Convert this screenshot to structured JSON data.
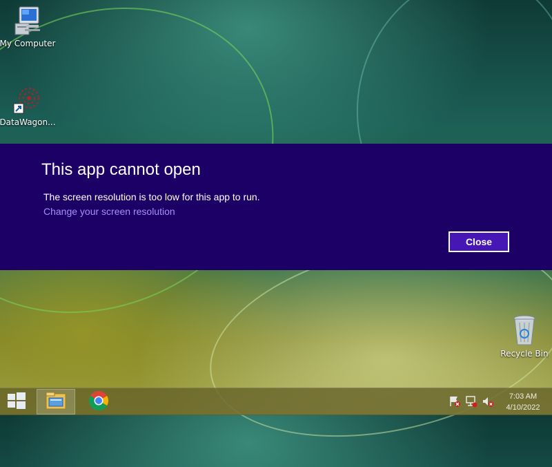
{
  "desktop": {
    "icons": [
      {
        "label": "My Computer",
        "icon": "my-computer-icon"
      },
      {
        "label": "DataWagon...",
        "icon": "datawagon-shortcut-icon"
      },
      {
        "label": "Recycle Bin",
        "icon": "recycle-bin-icon"
      }
    ]
  },
  "dialog": {
    "title": "This app cannot open",
    "message": "The screen resolution is too low for this app to run.",
    "link": "Change your screen resolution",
    "close_label": "Close",
    "colors": {
      "band": "#1c0066",
      "button": "#4617b4",
      "link": "#a78cff"
    }
  },
  "taskbar": {
    "start_icon": "windows-logo-icon",
    "pinned": [
      {
        "name": "file-explorer",
        "icon": "file-explorer-icon",
        "active": true
      },
      {
        "name": "chrome",
        "icon": "chrome-icon",
        "active": false
      }
    ],
    "tray_icons": [
      "action-center-flag-icon",
      "network-icon",
      "volume-muted-icon"
    ],
    "clock": {
      "time": "7:03 AM",
      "date": "4/10/2022"
    }
  }
}
